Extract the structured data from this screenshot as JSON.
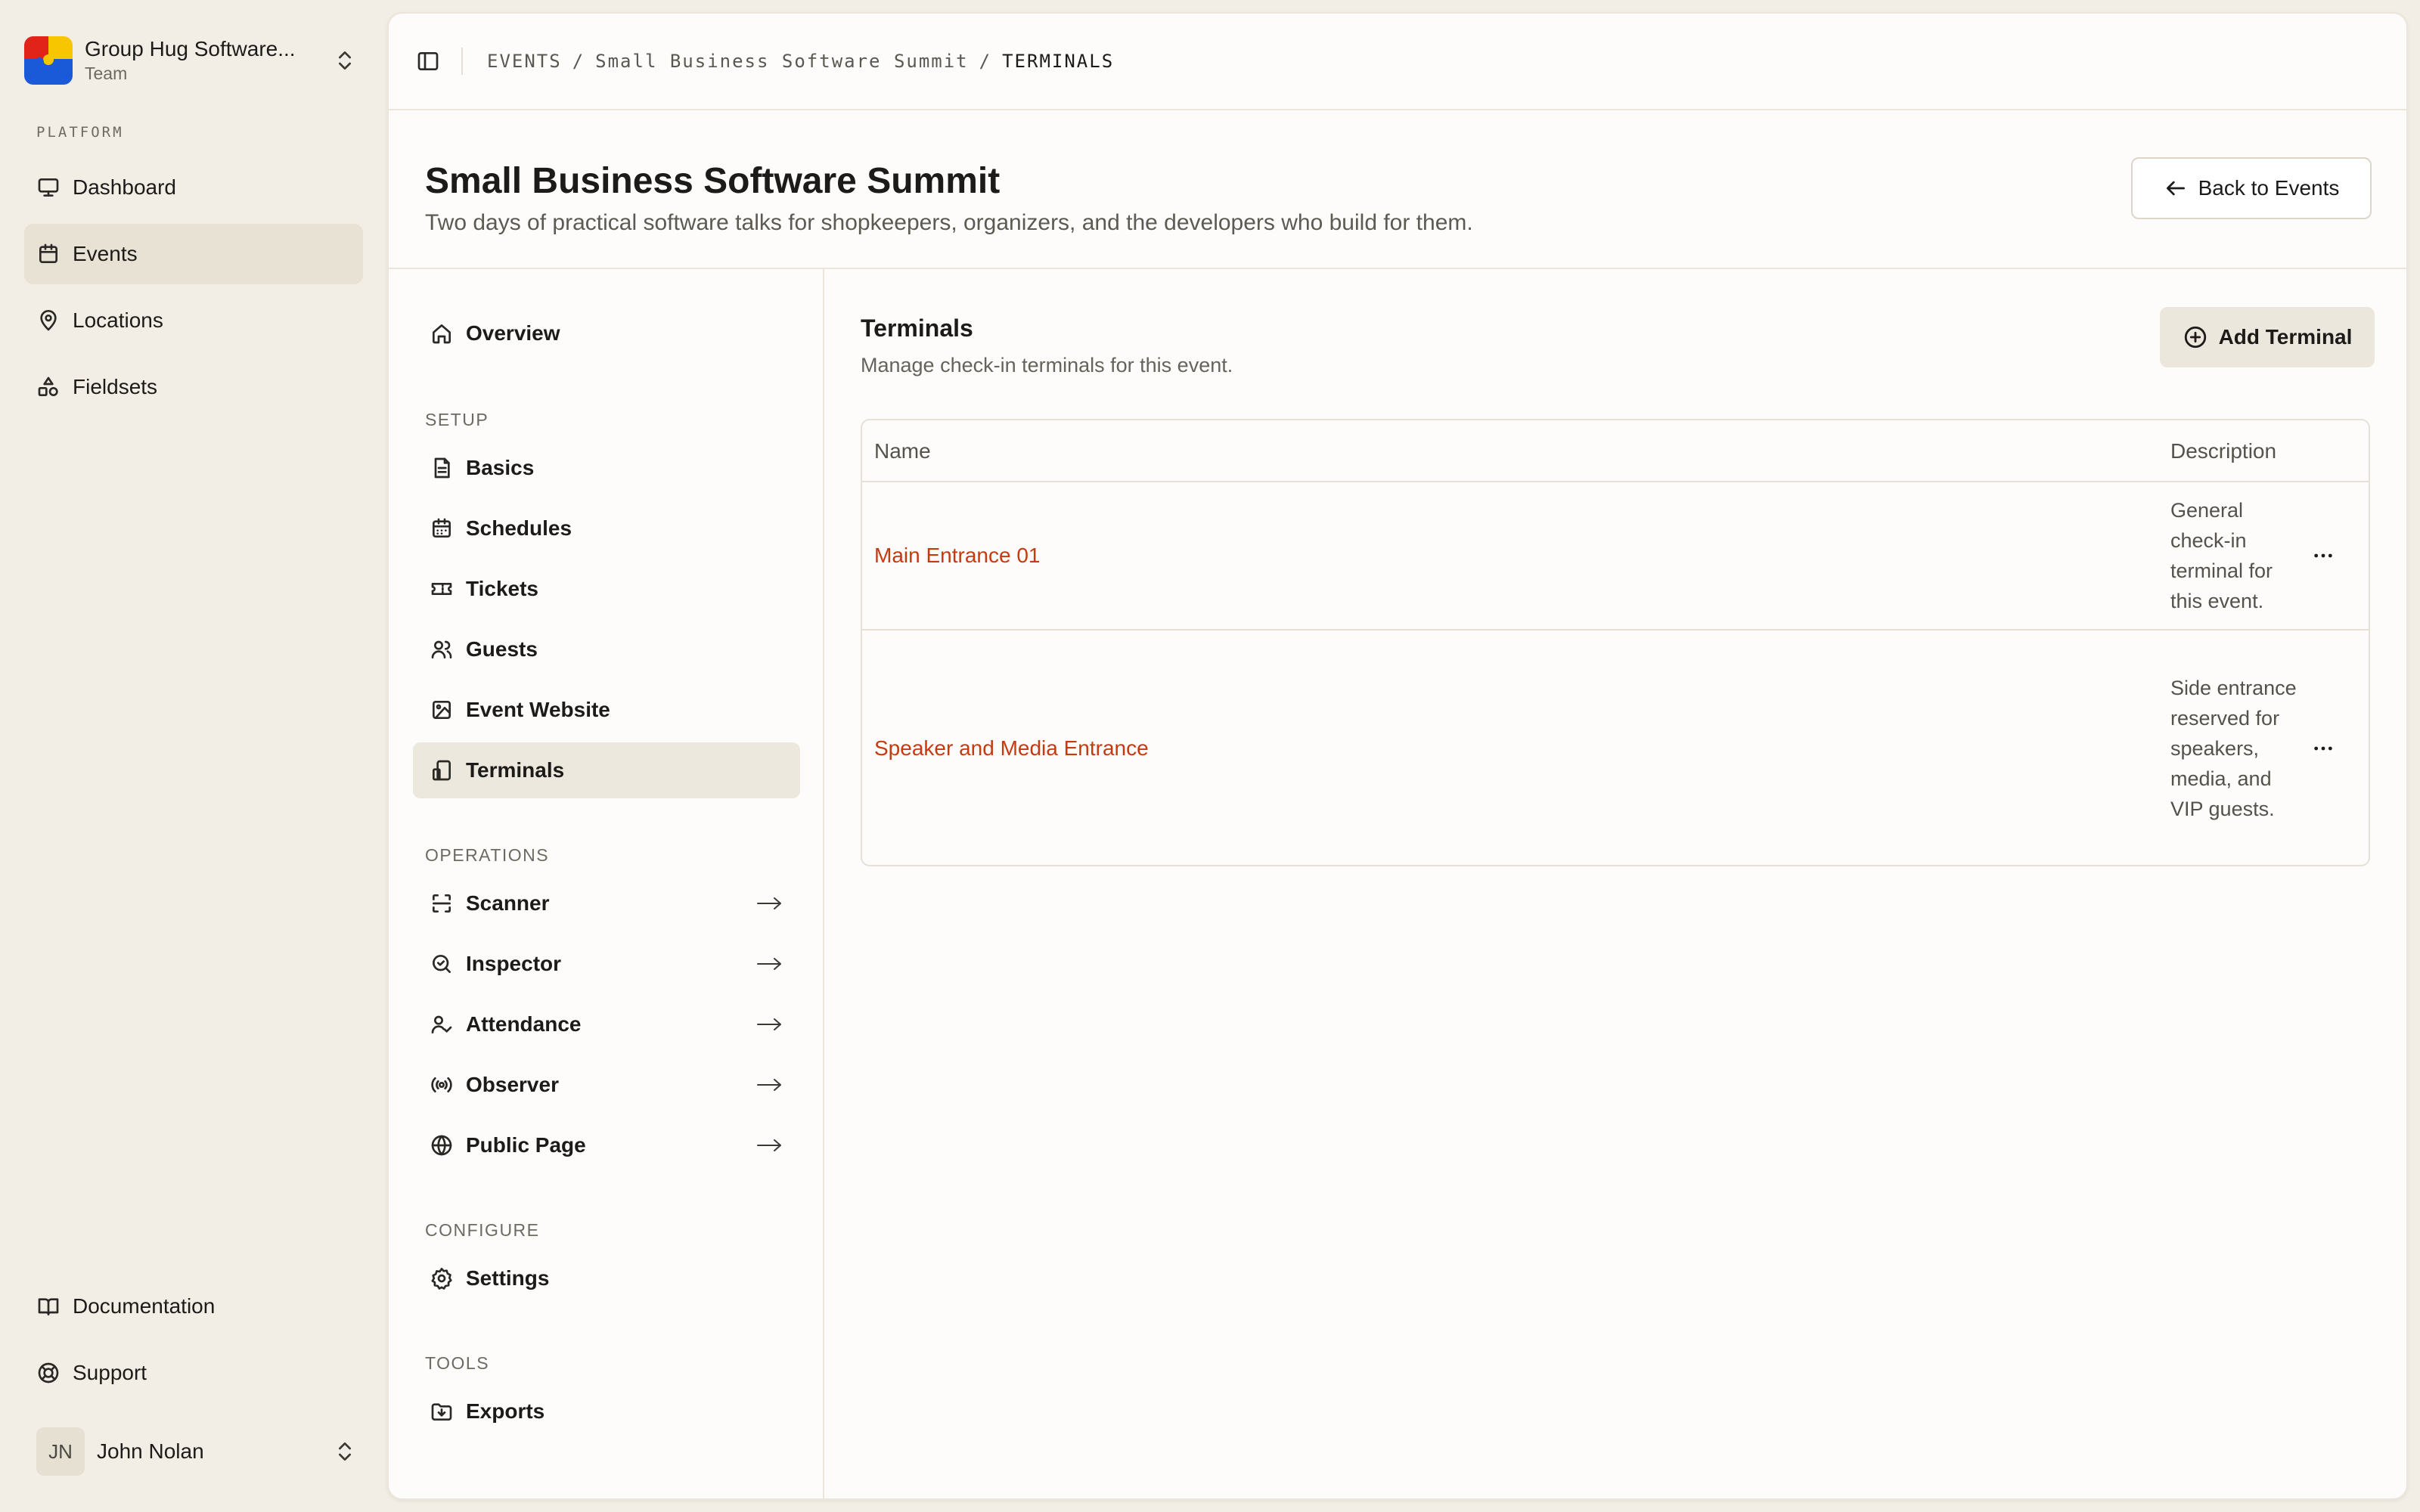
{
  "team": {
    "name": "Group Hug Software...",
    "subtitle": "Team"
  },
  "sidebar": {
    "section_label": "PLATFORM",
    "items": [
      {
        "label": "Dashboard",
        "icon": "monitor-icon"
      },
      {
        "label": "Events",
        "icon": "calendar-icon",
        "active": true
      },
      {
        "label": "Locations",
        "icon": "map-pin-icon"
      },
      {
        "label": "Fieldsets",
        "icon": "shapes-icon"
      }
    ],
    "bottom_items": [
      {
        "label": "Documentation",
        "icon": "book-icon"
      },
      {
        "label": "Support",
        "icon": "lifebuoy-icon"
      }
    ]
  },
  "user": {
    "initials": "JN",
    "name": "John Nolan"
  },
  "breadcrumb": [
    "EVENTS",
    "Small Business Software Summit",
    "TERMINALS"
  ],
  "breadcrumb_sep": "/",
  "page": {
    "title": "Small Business Software Summit",
    "subtitle": "Two days of practical software talks for shopkeepers, organizers, and the developers who build for them.",
    "back_label": "Back to Events"
  },
  "subnav": {
    "overview": "Overview",
    "setup_label": "SETUP",
    "setup": [
      "Basics",
      "Schedules",
      "Tickets",
      "Guests",
      "Event Website",
      "Terminals"
    ],
    "operations_label": "OPERATIONS",
    "operations": [
      "Scanner",
      "Inspector",
      "Attendance",
      "Observer",
      "Public Page"
    ],
    "configure_label": "CONFIGURE",
    "configure": [
      "Settings"
    ],
    "tools_label": "TOOLS",
    "tools": [
      "Exports"
    ]
  },
  "content": {
    "title": "Terminals",
    "subtitle": "Manage check-in terminals for this event.",
    "add_label": "Add Terminal",
    "columns": {
      "name": "Name",
      "description": "Description"
    },
    "rows": [
      {
        "name": "Main Entrance 01",
        "description": "General check-in terminal for this event."
      },
      {
        "name": "Speaker and Media Entrance",
        "description": "Side entrance reserved for speakers, media, and VIP guests."
      }
    ]
  },
  "colors": {
    "accent_link": "#c63a12",
    "sidebar_bg": "#f2eee5",
    "panel_bg": "#fdfcfa",
    "active_bg": "#e8e2d4"
  }
}
